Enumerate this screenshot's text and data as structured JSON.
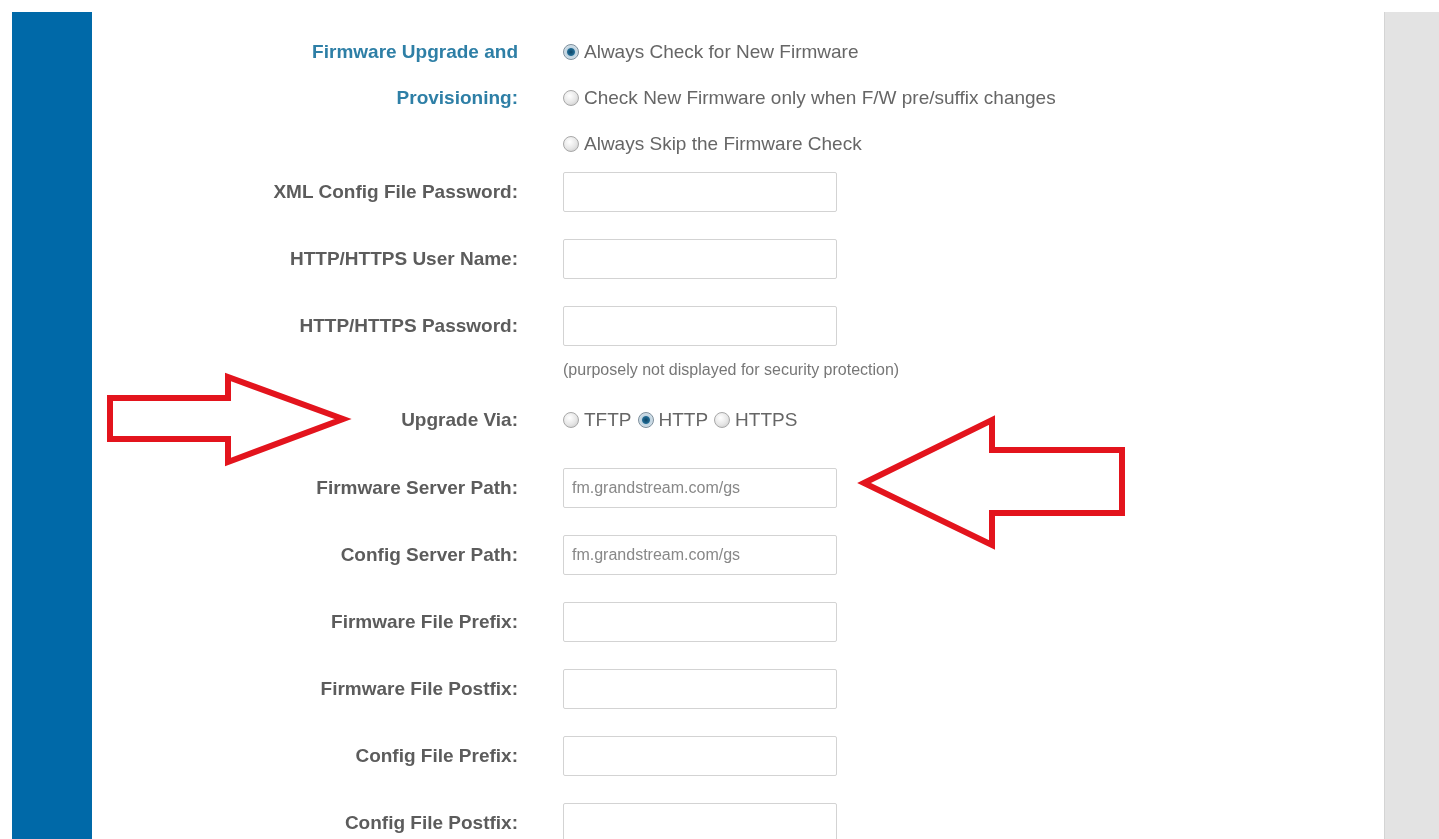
{
  "rows": [
    {
      "kind": "radio-stack",
      "label": "Firmware Upgrade and Provisioning:",
      "options": [
        {
          "label": "Always Check for New Firmware",
          "selected": true
        },
        {
          "label": "Check New Firmware only when F/W pre/suffix changes",
          "selected": false
        },
        {
          "label": "Always Skip the Firmware Check",
          "selected": false
        }
      ]
    },
    {
      "kind": "field",
      "label": "XML Config File Password:"
    },
    {
      "kind": "field",
      "label": "HTTP/HTTPS User Name:"
    },
    {
      "kind": "field",
      "label": "HTTP/HTTPS Password:",
      "note": "(purposely not displayed for security protection)"
    },
    {
      "kind": "radio-inline",
      "label": "Upgrade Via:",
      "options": [
        {
          "label": "TFTP",
          "selected": false
        },
        {
          "label": "HTTP",
          "selected": true
        },
        {
          "label": "HTTPS",
          "selected": false
        }
      ]
    },
    {
      "kind": "field",
      "label": "Firmware Server Path:",
      "value": "fm.grandstream.com/gs"
    },
    {
      "kind": "field",
      "label": "Config Server Path:",
      "value": "fm.grandstream.com/gs"
    },
    {
      "kind": "field",
      "label": "Firmware File Prefix:"
    },
    {
      "kind": "field",
      "label": "Firmware File Postfix:"
    },
    {
      "kind": "field",
      "label": "Config File Prefix:"
    },
    {
      "kind": "field",
      "label": "Config File Postfix:"
    }
  ],
  "annotations": [
    {
      "kind": "right"
    },
    {
      "kind": "left"
    }
  ]
}
